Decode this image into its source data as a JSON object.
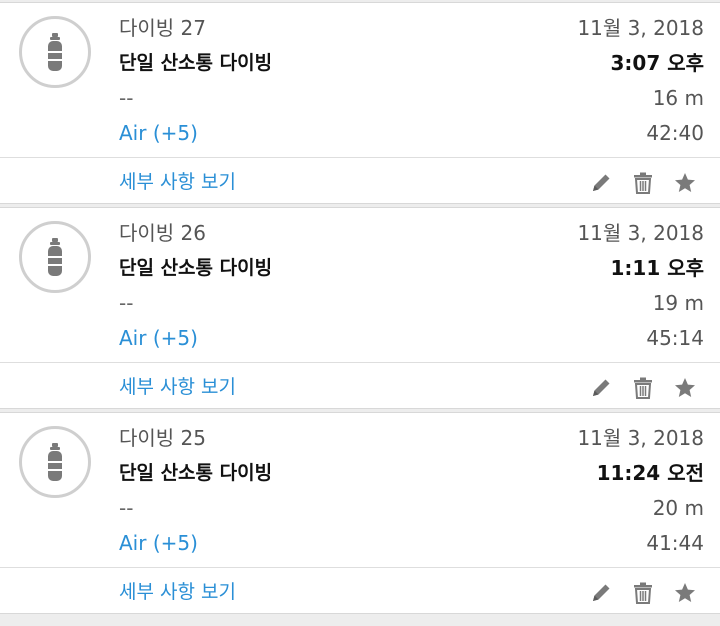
{
  "colors": {
    "accent": "#2a8fd6",
    "icon_gray": "#7a7a7a",
    "ring_gray": "#cfcfcf"
  },
  "icons": {
    "avatar": "tank-icon",
    "edit": "pencil-icon",
    "delete": "trash-icon",
    "favorite": "star-icon"
  },
  "dives": [
    {
      "number": "다이빙 27",
      "type": "단일 산소통 다이빙",
      "notes": "--",
      "gas": "Air (+5)",
      "date": "11월 3, 2018",
      "time": "3:07 오후",
      "depth": "16 m",
      "duration": "42:40",
      "details_label": "세부 사항 보기"
    },
    {
      "number": "다이빙 26",
      "type": "단일 산소통 다이빙",
      "notes": "--",
      "gas": "Air (+5)",
      "date": "11월 3, 2018",
      "time": "1:11 오후",
      "depth": "19 m",
      "duration": "45:14",
      "details_label": "세부 사항 보기"
    },
    {
      "number": "다이빙 25",
      "type": "단일 산소통 다이빙",
      "notes": "--",
      "gas": "Air (+5)",
      "date": "11월 3, 2018",
      "time": "11:24 오전",
      "depth": "20 m",
      "duration": "41:44",
      "details_label": "세부 사항 보기"
    }
  ]
}
